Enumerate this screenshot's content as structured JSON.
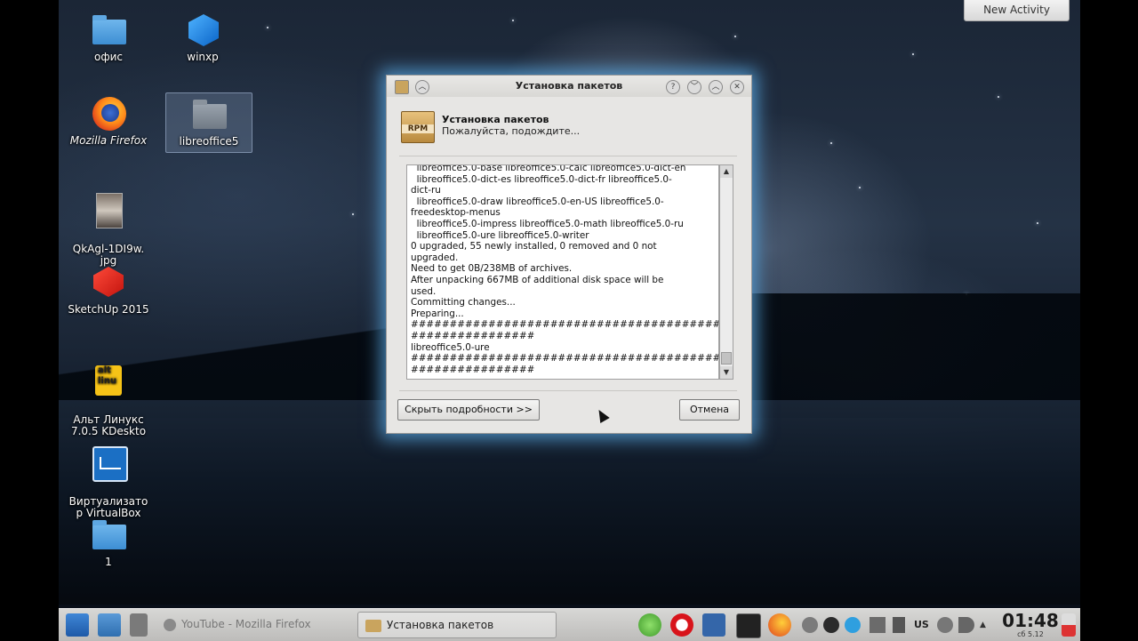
{
  "desktop": {
    "icons": [
      {
        "label": "офис"
      },
      {
        "label": "winxp"
      },
      {
        "label": "Mozilla Firefox"
      },
      {
        "label": "libreoffice5"
      },
      {
        "label": "QkAgl-1DI9w.\njpg"
      },
      {
        "label": "SketchUp 2015"
      },
      {
        "label": "Альт Линукс\n7.0.5 KDeskto"
      },
      {
        "label": "Виртуализато\nр VirtualBox"
      },
      {
        "label": "1"
      }
    ],
    "new_activity": "New Activity",
    "alt_logo": "alt\nlinu"
  },
  "dialog": {
    "title": "Установка пакетов",
    "header_title": "Установка пакетов",
    "header_subtitle": "Пожалуйста, подождите...",
    "header_icon_text": "RPM",
    "log": "  libreoffice5.0-base libreoffice5.0-calc libreoffice5.0-dict-en\n  libreoffice5.0-dict-es libreoffice5.0-dict-fr libreoffice5.0-\ndict-ru\n  libreoffice5.0-draw libreoffice5.0-en-US libreoffice5.0-\nfreedesktop-menus\n  libreoffice5.0-impress libreoffice5.0-math libreoffice5.0-ru\n  libreoffice5.0-ure libreoffice5.0-writer\n0 upgraded, 55 newly installed, 0 removed and 0 not\nupgraded.\nNeed to get 0B/238MB of archives.\nAfter unpacking 667MB of additional disk space will be\nused.\nCommitting changes...\nPreparing...\n##############################################\n################\nlibreoffice5.0-ure\n##############################################\n################",
    "details_button": "Скрыть подробности >>",
    "cancel_button": "Отмена",
    "help_glyph": "?",
    "close_glyph": "✕"
  },
  "taskbar": {
    "tasks": [
      {
        "label": "YouTube - Mozilla Firefox"
      },
      {
        "label": "Установка пакетов"
      }
    ],
    "keyboard_layout": "US",
    "clock": "01:48",
    "date": "сб 5.12"
  },
  "colors": {
    "window_glow": "#5aaae6",
    "taskbar_bg": "#c9c8c6",
    "folder_blue": "#4f9fdf"
  }
}
